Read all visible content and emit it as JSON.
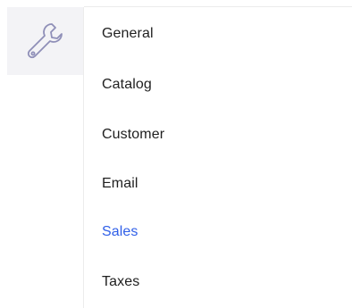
{
  "sidebar": {
    "icon": "wrench-icon"
  },
  "menu": {
    "items": [
      {
        "label": "General",
        "active": false
      },
      {
        "label": "Catalog",
        "active": false
      },
      {
        "label": "Customer",
        "active": false
      },
      {
        "label": "Email",
        "active": false
      },
      {
        "label": "Sales",
        "active": true
      },
      {
        "label": "Taxes",
        "active": false
      }
    ]
  },
  "colors": {
    "active_text": "#2f5fe8",
    "text": "#1f1f1f",
    "icon": "#8f8fb8",
    "tile_bg": "#f3f3f6"
  }
}
